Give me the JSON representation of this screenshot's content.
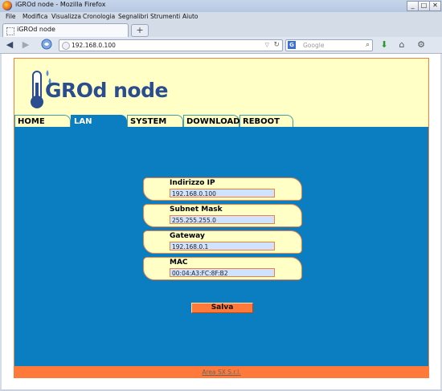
{
  "window": {
    "title": "iGROd node - Mozilla Firefox"
  },
  "menu": [
    "File",
    "Modifica",
    "Visualizza",
    "Cronologia",
    "Segnalibri",
    "Strumenti",
    "Aiuto"
  ],
  "tab": {
    "title": "iGROd node",
    "new_tab_label": "+"
  },
  "toolbar": {
    "url": "192.168.0.100",
    "search_placeholder": "Google"
  },
  "page": {
    "logo_text": "GROd node",
    "nav": [
      "HOME",
      "LAN",
      "SYSTEM",
      "DOWNLOAD",
      "REBOOT"
    ],
    "active_nav": "LAN",
    "fields": [
      {
        "label": "Indirizzo IP",
        "value": "192.168.0.100"
      },
      {
        "label": "Subnet Mask",
        "value": "255.255.255.0"
      },
      {
        "label": "Gateway",
        "value": "192.168.0.1"
      },
      {
        "label": "MAC",
        "value": "00:04:A3:FC:8F:B2"
      }
    ],
    "save_label": "Salva",
    "footer_link": "Area SX S.r.l."
  },
  "colors": {
    "header_bg": "#ffffc6",
    "main_bg": "#0a7ec0",
    "accent": "#ff7a3a",
    "logo": "#2a4d8f"
  }
}
